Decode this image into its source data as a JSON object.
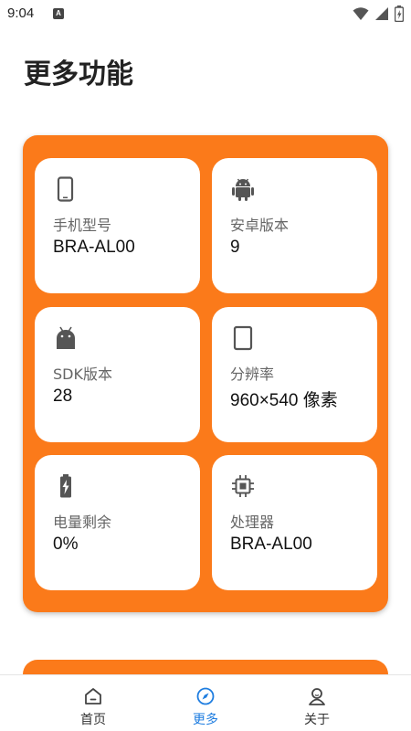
{
  "status_bar": {
    "time": "9:04",
    "notification_letter": "A"
  },
  "page": {
    "title": "更多功能"
  },
  "tiles": [
    {
      "label": "手机型号",
      "value": "BRA-AL00",
      "icon": "phone-icon"
    },
    {
      "label": "安卓版本",
      "value": "9",
      "icon": "android-icon"
    },
    {
      "label": "SDK版本",
      "value": "28",
      "icon": "android-head-icon"
    },
    {
      "label": "分辨率",
      "value": "960×540 像素",
      "icon": "tablet-icon"
    },
    {
      "label": "电量剩余",
      "value": "0%",
      "icon": "battery-charging-icon"
    },
    {
      "label": "处理器",
      "value": "BRA-AL00",
      "icon": "cpu-chip-icon"
    }
  ],
  "bottom_nav": {
    "items": [
      {
        "label": "首页",
        "icon": "home-icon",
        "active": false
      },
      {
        "label": "更多",
        "icon": "compass-icon",
        "active": true
      },
      {
        "label": "关于",
        "icon": "person-icon",
        "active": false
      }
    ],
    "active_color": "#1e7de0"
  },
  "colors": {
    "card": "#fb7a1a",
    "tile": "#ffffff"
  }
}
